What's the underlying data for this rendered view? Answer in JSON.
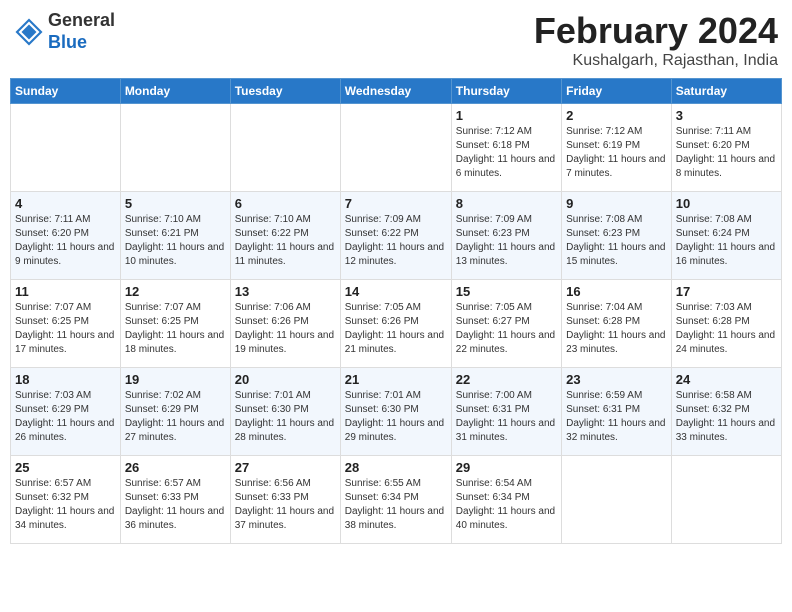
{
  "header": {
    "logo_line1": "General",
    "logo_line2": "Blue",
    "month": "February 2024",
    "location": "Kushalgarh, Rajasthan, India"
  },
  "days_of_week": [
    "Sunday",
    "Monday",
    "Tuesday",
    "Wednesday",
    "Thursday",
    "Friday",
    "Saturday"
  ],
  "weeks": [
    [
      {
        "num": "",
        "info": ""
      },
      {
        "num": "",
        "info": ""
      },
      {
        "num": "",
        "info": ""
      },
      {
        "num": "",
        "info": ""
      },
      {
        "num": "1",
        "info": "Sunrise: 7:12 AM\nSunset: 6:18 PM\nDaylight: 11 hours and 6 minutes."
      },
      {
        "num": "2",
        "info": "Sunrise: 7:12 AM\nSunset: 6:19 PM\nDaylight: 11 hours and 7 minutes."
      },
      {
        "num": "3",
        "info": "Sunrise: 7:11 AM\nSunset: 6:20 PM\nDaylight: 11 hours and 8 minutes."
      }
    ],
    [
      {
        "num": "4",
        "info": "Sunrise: 7:11 AM\nSunset: 6:20 PM\nDaylight: 11 hours and 9 minutes."
      },
      {
        "num": "5",
        "info": "Sunrise: 7:10 AM\nSunset: 6:21 PM\nDaylight: 11 hours and 10 minutes."
      },
      {
        "num": "6",
        "info": "Sunrise: 7:10 AM\nSunset: 6:22 PM\nDaylight: 11 hours and 11 minutes."
      },
      {
        "num": "7",
        "info": "Sunrise: 7:09 AM\nSunset: 6:22 PM\nDaylight: 11 hours and 12 minutes."
      },
      {
        "num": "8",
        "info": "Sunrise: 7:09 AM\nSunset: 6:23 PM\nDaylight: 11 hours and 13 minutes."
      },
      {
        "num": "9",
        "info": "Sunrise: 7:08 AM\nSunset: 6:23 PM\nDaylight: 11 hours and 15 minutes."
      },
      {
        "num": "10",
        "info": "Sunrise: 7:08 AM\nSunset: 6:24 PM\nDaylight: 11 hours and 16 minutes."
      }
    ],
    [
      {
        "num": "11",
        "info": "Sunrise: 7:07 AM\nSunset: 6:25 PM\nDaylight: 11 hours and 17 minutes."
      },
      {
        "num": "12",
        "info": "Sunrise: 7:07 AM\nSunset: 6:25 PM\nDaylight: 11 hours and 18 minutes."
      },
      {
        "num": "13",
        "info": "Sunrise: 7:06 AM\nSunset: 6:26 PM\nDaylight: 11 hours and 19 minutes."
      },
      {
        "num": "14",
        "info": "Sunrise: 7:05 AM\nSunset: 6:26 PM\nDaylight: 11 hours and 21 minutes."
      },
      {
        "num": "15",
        "info": "Sunrise: 7:05 AM\nSunset: 6:27 PM\nDaylight: 11 hours and 22 minutes."
      },
      {
        "num": "16",
        "info": "Sunrise: 7:04 AM\nSunset: 6:28 PM\nDaylight: 11 hours and 23 minutes."
      },
      {
        "num": "17",
        "info": "Sunrise: 7:03 AM\nSunset: 6:28 PM\nDaylight: 11 hours and 24 minutes."
      }
    ],
    [
      {
        "num": "18",
        "info": "Sunrise: 7:03 AM\nSunset: 6:29 PM\nDaylight: 11 hours and 26 minutes."
      },
      {
        "num": "19",
        "info": "Sunrise: 7:02 AM\nSunset: 6:29 PM\nDaylight: 11 hours and 27 minutes."
      },
      {
        "num": "20",
        "info": "Sunrise: 7:01 AM\nSunset: 6:30 PM\nDaylight: 11 hours and 28 minutes."
      },
      {
        "num": "21",
        "info": "Sunrise: 7:01 AM\nSunset: 6:30 PM\nDaylight: 11 hours and 29 minutes."
      },
      {
        "num": "22",
        "info": "Sunrise: 7:00 AM\nSunset: 6:31 PM\nDaylight: 11 hours and 31 minutes."
      },
      {
        "num": "23",
        "info": "Sunrise: 6:59 AM\nSunset: 6:31 PM\nDaylight: 11 hours and 32 minutes."
      },
      {
        "num": "24",
        "info": "Sunrise: 6:58 AM\nSunset: 6:32 PM\nDaylight: 11 hours and 33 minutes."
      }
    ],
    [
      {
        "num": "25",
        "info": "Sunrise: 6:57 AM\nSunset: 6:32 PM\nDaylight: 11 hours and 34 minutes."
      },
      {
        "num": "26",
        "info": "Sunrise: 6:57 AM\nSunset: 6:33 PM\nDaylight: 11 hours and 36 minutes."
      },
      {
        "num": "27",
        "info": "Sunrise: 6:56 AM\nSunset: 6:33 PM\nDaylight: 11 hours and 37 minutes."
      },
      {
        "num": "28",
        "info": "Sunrise: 6:55 AM\nSunset: 6:34 PM\nDaylight: 11 hours and 38 minutes."
      },
      {
        "num": "29",
        "info": "Sunrise: 6:54 AM\nSunset: 6:34 PM\nDaylight: 11 hours and 40 minutes."
      },
      {
        "num": "",
        "info": ""
      },
      {
        "num": "",
        "info": ""
      }
    ]
  ]
}
